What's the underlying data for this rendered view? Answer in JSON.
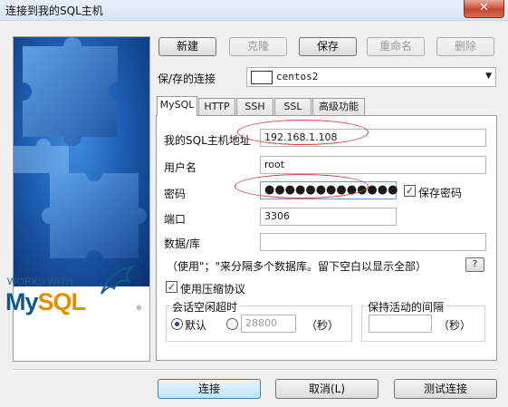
{
  "window": {
    "title": "连接到我的SQL主机",
    "close_symbol": "✕"
  },
  "branding": {
    "works_with": "WORKS WITH",
    "mysql_my": "My",
    "mysql_sql": "SQL",
    "registered": "®"
  },
  "toolbar": {
    "new_label": "新建",
    "clone_label": "克隆",
    "save_label": "保存",
    "rename_label": "重命名",
    "delete_label": "删除"
  },
  "saved_connection": {
    "label": "保/存的连接",
    "value": "centos2",
    "arrow": "▼"
  },
  "tabs": [
    {
      "label": "MySQL",
      "active": true
    },
    {
      "label": "HTTP",
      "active": false
    },
    {
      "label": "SSH",
      "active": false
    },
    {
      "label": "SSL",
      "active": false
    },
    {
      "label": "高级功能",
      "active": false
    }
  ],
  "form": {
    "host_label": "我的SQL主机地址",
    "host_value": "192.168.1.108",
    "user_label": "用户名",
    "user_value": "root",
    "password_label": "密码",
    "password_value": "●●●●●●●●●●●●●",
    "save_password_label": "保存密码",
    "save_password_checked": true,
    "port_label": "端口",
    "port_value": "3306",
    "database_label": "数据/库",
    "database_value": "",
    "database_hint": "（使用\"；\"来分隔多个数据库。留下空白以显示全部）",
    "help_label": "?",
    "compression_label": "使用压缩协议",
    "compression_checked": true
  },
  "session_timeout": {
    "title": "会话空闲超时",
    "default_label": "默认",
    "default_selected": true,
    "seconds_value": "28800",
    "seconds_unit": "（秒）"
  },
  "keepalive": {
    "title": "保持活动的间隔",
    "value": "",
    "unit": "（秒）"
  },
  "footer": {
    "connect_label": "连接",
    "cancel_label": "取消(L)",
    "test_label": "测试连接"
  },
  "annotation_color": "#d84040",
  "brand_colors": {
    "mysql_blue": "#0f5a88",
    "mysql_orange": "#e48e00"
  }
}
